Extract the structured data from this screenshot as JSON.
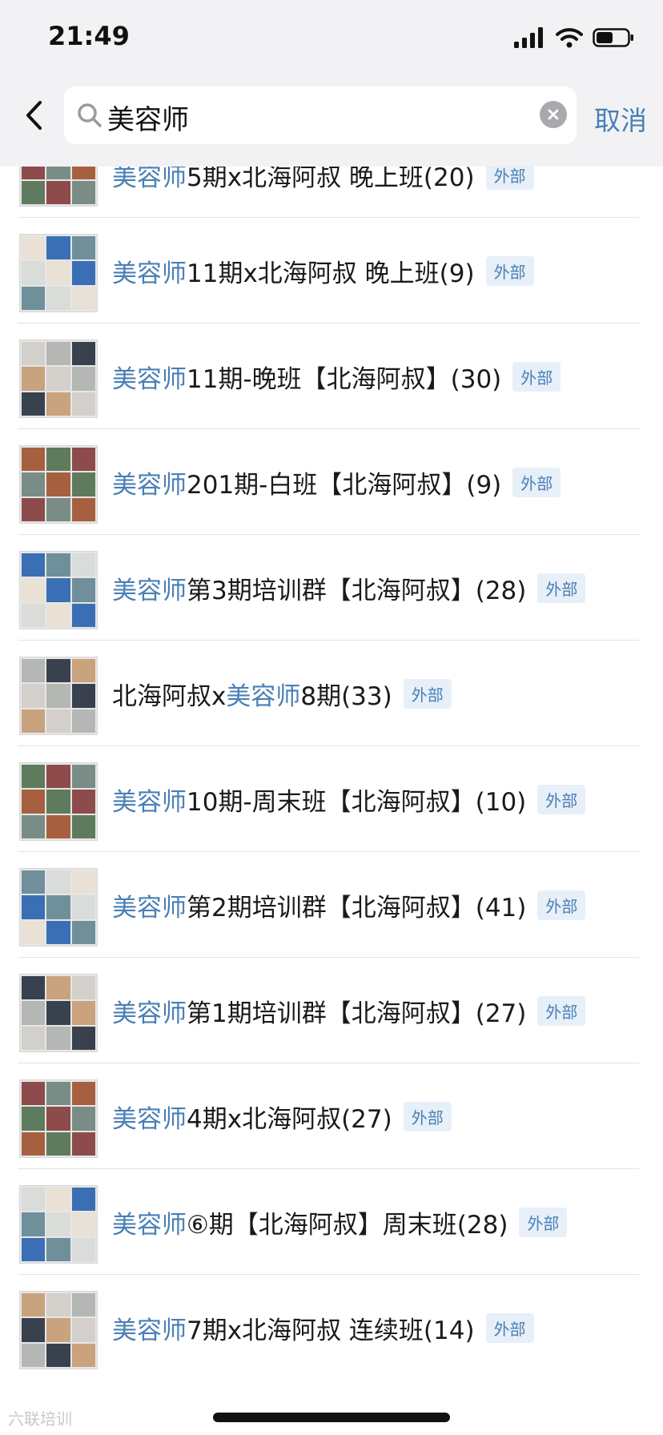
{
  "status_bar": {
    "time": "21:49"
  },
  "search": {
    "query": "美容师",
    "cancel_label": "取消"
  },
  "groups": [
    {
      "prefix": "",
      "highlight": "美容师",
      "suffix": "5期x北海阿叔 晚上班(20)",
      "badge": "外部"
    },
    {
      "prefix": "",
      "highlight": "美容师",
      "suffix": "11期x北海阿叔 晚上班(9)",
      "badge": "外部"
    },
    {
      "prefix": "",
      "highlight": "美容师",
      "suffix": "11期-晚班【北海阿叔】(30)",
      "badge": "外部"
    },
    {
      "prefix": "",
      "highlight": "美容师",
      "suffix": "201期-白班【北海阿叔】(9)",
      "badge": "外部"
    },
    {
      "prefix": "",
      "highlight": "美容师",
      "suffix": "第3期培训群【北海阿叔】(28)",
      "badge": "外部"
    },
    {
      "prefix": "北海阿叔x",
      "highlight": "美容师",
      "suffix": "8期(33)",
      "badge": "外部"
    },
    {
      "prefix": "",
      "highlight": "美容师",
      "suffix": "10期-周末班【北海阿叔】(10)",
      "badge": "外部"
    },
    {
      "prefix": "",
      "highlight": "美容师",
      "suffix": "第2期培训群【北海阿叔】(41)",
      "badge": "外部"
    },
    {
      "prefix": "",
      "highlight": "美容师",
      "suffix": "第1期培训群【北海阿叔】(27)",
      "badge": "外部"
    },
    {
      "prefix": "",
      "highlight": "美容师",
      "suffix": "4期x北海阿叔(27)",
      "badge": "外部"
    },
    {
      "prefix": "",
      "highlight": "美容师",
      "suffix": "⑥期【北海阿叔】周末班(28)",
      "badge": "外部"
    },
    {
      "prefix": "",
      "highlight": "美容师",
      "suffix": "7期x北海阿叔 连续班(14)",
      "badge": "外部"
    }
  ],
  "watermark": "六联培训",
  "colors": {
    "highlight": "#4a7fb5",
    "badge_bg": "#e7eff8",
    "header_bg": "#f2f2f4"
  }
}
